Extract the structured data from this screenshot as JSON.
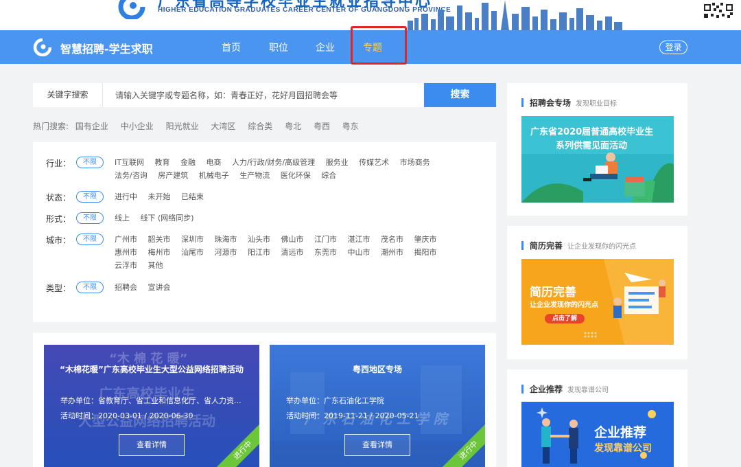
{
  "banner": {
    "title_cn": "广东省高等学校毕业生就业指导中心",
    "title_en": "HIGHER EDUCATION GRADUATES CAREER CENTER OF GUANGDONG PROVINCE"
  },
  "nav": {
    "brand": "智慧招聘-学生求职",
    "items": [
      "首页",
      "职位",
      "企业",
      "专题"
    ],
    "active_index": 3,
    "login": "登录"
  },
  "search": {
    "label": "关键字搜索",
    "placeholder": "请输入关键字或专题名称，如：青春正好，花好月圆招聘会等",
    "button": "搜索"
  },
  "hot": {
    "label": "热门搜索:",
    "tags": [
      "国有企业",
      "中小企业",
      "阳光就业",
      "大湾区",
      "综合类",
      "粤北",
      "粤西",
      "粤东"
    ]
  },
  "filters": {
    "all_label": "不限",
    "industry": {
      "label": "行业：",
      "options": [
        "IT互联网",
        "教育",
        "金融",
        "电商",
        "人力/行政/财务/高级管理",
        "服务业",
        "传媒艺术",
        "市场商务",
        "法务/咨询",
        "房产建筑",
        "机械电子",
        "生产物流",
        "医化环保",
        "综合"
      ]
    },
    "status": {
      "label": "状态：",
      "options": [
        "进行中",
        "未开始",
        "已结束"
      ]
    },
    "format": {
      "label": "形式：",
      "options": [
        "线上",
        "线下 (网络同步)"
      ]
    },
    "city": {
      "label": "城市：",
      "options": [
        "广州市",
        "韶关市",
        "深圳市",
        "珠海市",
        "汕头市",
        "佛山市",
        "江门市",
        "湛江市",
        "茂名市",
        "肇庆市",
        "惠州市",
        "梅州市",
        "汕尾市",
        "河源市",
        "阳江市",
        "清远市",
        "东莞市",
        "中山市",
        "潮州市",
        "揭阳市",
        "云浮市",
        "其他"
      ]
    },
    "type": {
      "label": "类型：",
      "options": [
        "招聘会",
        "宣讲会"
      ]
    }
  },
  "cards": [
    {
      "title": "“木棉花暖”广东高校毕业生大型公益网络招聘活动",
      "organizer": "举办单位：省教育厅、省工业和信息化厅、省人力资...",
      "time": "活动时间：2020-03-01 / 2020-06-30",
      "button": "查看详情",
      "status": "进行中",
      "bg_text_1": "“木 棉 花 暖”",
      "bg_text_2": "广东高校毕业生",
      "bg_text_3": "大型公益网络招聘活动"
    },
    {
      "title": "粤西地区专场",
      "organizer": "举办单位：广东石油化工学院",
      "time": "活动时间：2019-11-21 / 2020-05-21",
      "button": "查看详情",
      "status": "进行中",
      "bg_text_1": "广 东 石 油 化 工 学 院"
    }
  ],
  "sidebar": {
    "fairs": {
      "title": "招聘会专场",
      "subtitle": "发现职业目标",
      "image_text": [
        "广东省2020届普通高校毕业生",
        "系列供需见面活动"
      ]
    },
    "resume": {
      "title": "简历完善",
      "subtitle": "让企业发现你的闪光点",
      "image_title": "简历完善",
      "image_sub": "让企业发现你的闪光点",
      "image_btn": "点击了解"
    },
    "company": {
      "title": "企业推荐",
      "subtitle": "发现靠谱公司",
      "image_title": "企业推荐",
      "image_sub": "发现靠谱公司"
    }
  },
  "colors": {
    "nav_bg": "#4a95f0",
    "accent": "#3c8cf0",
    "active_nav": "#ffd15c",
    "highlight_box": "#e8231f",
    "status_green": "#6bc63a"
  }
}
